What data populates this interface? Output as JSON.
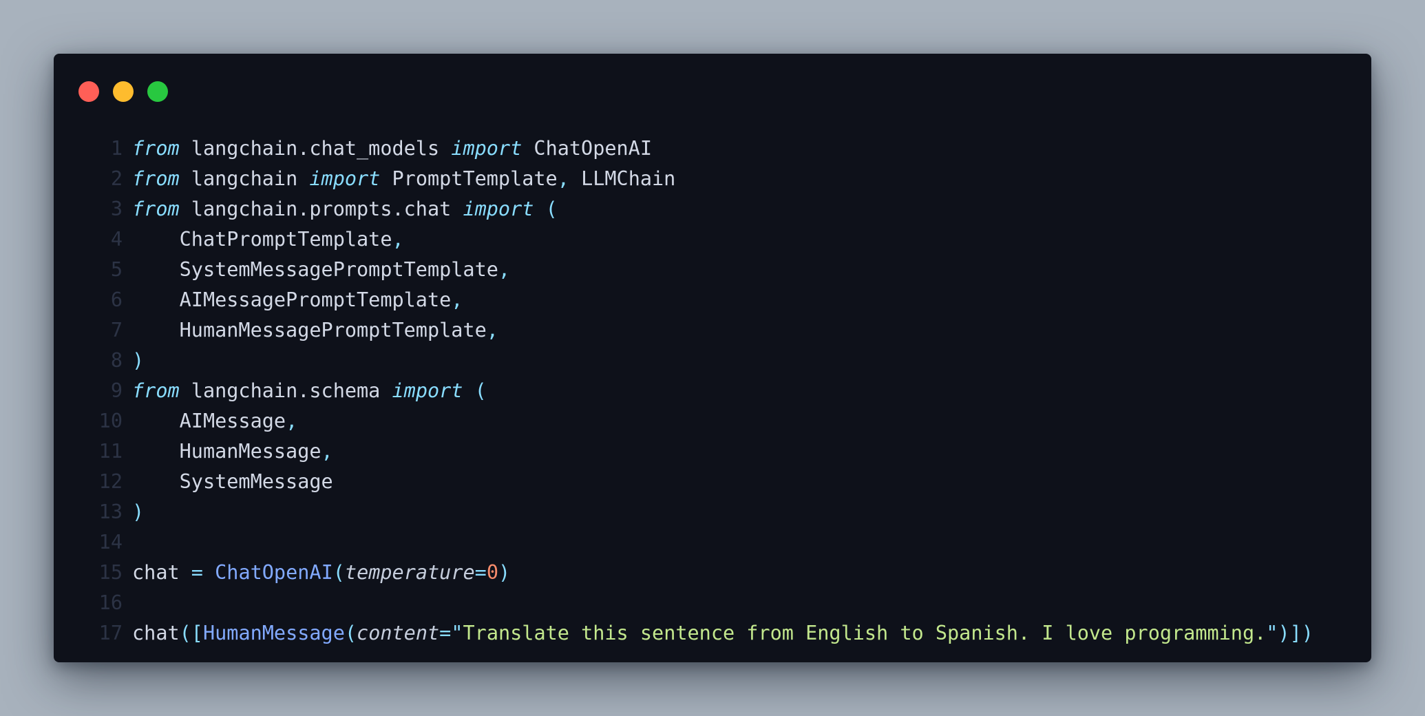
{
  "window": {
    "buttons": {
      "close_color": "#ff5f57",
      "minimize_color": "#febc2e",
      "maximize_color": "#28c840"
    }
  },
  "theme": {
    "keyword": "#89ddff",
    "punctuation": "#89ddff",
    "function": "#82aaff",
    "number": "#f78c6c",
    "string": "#c3e88d",
    "text": "#d3d9e6",
    "line_number": "#2c3345",
    "background": "#0e111a"
  },
  "code": {
    "lines": [
      {
        "n": "1",
        "tokens": [
          {
            "t": "from",
            "k": "kw"
          },
          {
            "t": " langchain.chat_models ",
            "k": "tx"
          },
          {
            "t": "import",
            "k": "kw"
          },
          {
            "t": " ChatOpenAI",
            "k": "tx"
          }
        ]
      },
      {
        "n": "2",
        "tokens": [
          {
            "t": "from",
            "k": "kw"
          },
          {
            "t": " langchain ",
            "k": "tx"
          },
          {
            "t": "import",
            "k": "kw"
          },
          {
            "t": " PromptTemplate",
            "k": "tx"
          },
          {
            "t": ",",
            "k": "pn"
          },
          {
            "t": " LLMChain",
            "k": "tx"
          }
        ]
      },
      {
        "n": "3",
        "tokens": [
          {
            "t": "from",
            "k": "kw"
          },
          {
            "t": " langchain.prompts.chat ",
            "k": "tx"
          },
          {
            "t": "import",
            "k": "kw"
          },
          {
            "t": " (",
            "k": "pn"
          }
        ]
      },
      {
        "n": "4",
        "tokens": [
          {
            "t": "    ChatPromptTemplate",
            "k": "tx"
          },
          {
            "t": ",",
            "k": "pn"
          }
        ]
      },
      {
        "n": "5",
        "tokens": [
          {
            "t": "    SystemMessagePromptTemplate",
            "k": "tx"
          },
          {
            "t": ",",
            "k": "pn"
          }
        ]
      },
      {
        "n": "6",
        "tokens": [
          {
            "t": "    AIMessagePromptTemplate",
            "k": "tx"
          },
          {
            "t": ",",
            "k": "pn"
          }
        ]
      },
      {
        "n": "7",
        "tokens": [
          {
            "t": "    HumanMessagePromptTemplate",
            "k": "tx"
          },
          {
            "t": ",",
            "k": "pn"
          }
        ]
      },
      {
        "n": "8",
        "tokens": [
          {
            "t": ")",
            "k": "pn"
          }
        ]
      },
      {
        "n": "9",
        "tokens": [
          {
            "t": "from",
            "k": "kw"
          },
          {
            "t": " langchain.schema ",
            "k": "tx"
          },
          {
            "t": "import",
            "k": "kw"
          },
          {
            "t": " (",
            "k": "pn"
          }
        ]
      },
      {
        "n": "10",
        "tokens": [
          {
            "t": "    AIMessage",
            "k": "tx"
          },
          {
            "t": ",",
            "k": "pn"
          }
        ]
      },
      {
        "n": "11",
        "tokens": [
          {
            "t": "    HumanMessage",
            "k": "tx"
          },
          {
            "t": ",",
            "k": "pn"
          }
        ]
      },
      {
        "n": "12",
        "tokens": [
          {
            "t": "    SystemMessage",
            "k": "tx"
          }
        ]
      },
      {
        "n": "13",
        "tokens": [
          {
            "t": ")",
            "k": "pn"
          }
        ]
      },
      {
        "n": "14",
        "tokens": []
      },
      {
        "n": "15",
        "tokens": [
          {
            "t": "chat ",
            "k": "tx"
          },
          {
            "t": "=",
            "k": "pn"
          },
          {
            "t": " ",
            "k": "tx"
          },
          {
            "t": "ChatOpenAI",
            "k": "fn"
          },
          {
            "t": "(",
            "k": "pn"
          },
          {
            "t": "temperature",
            "k": "pm"
          },
          {
            "t": "=",
            "k": "pn"
          },
          {
            "t": "0",
            "k": "num"
          },
          {
            "t": ")",
            "k": "pn"
          }
        ]
      },
      {
        "n": "16",
        "tokens": []
      },
      {
        "n": "17",
        "tokens": [
          {
            "t": "chat",
            "k": "tx"
          },
          {
            "t": "([",
            "k": "pn"
          },
          {
            "t": "HumanMessage",
            "k": "fn"
          },
          {
            "t": "(",
            "k": "pn"
          },
          {
            "t": "content",
            "k": "pm"
          },
          {
            "t": "=",
            "k": "pn"
          },
          {
            "t": "\"",
            "k": "pn"
          },
          {
            "t": "Translate this sentence from English to Spanish. I love programming.",
            "k": "str"
          },
          {
            "t": "\"",
            "k": "pn"
          },
          {
            "t": ")])",
            "k": "pn"
          }
        ]
      }
    ]
  }
}
